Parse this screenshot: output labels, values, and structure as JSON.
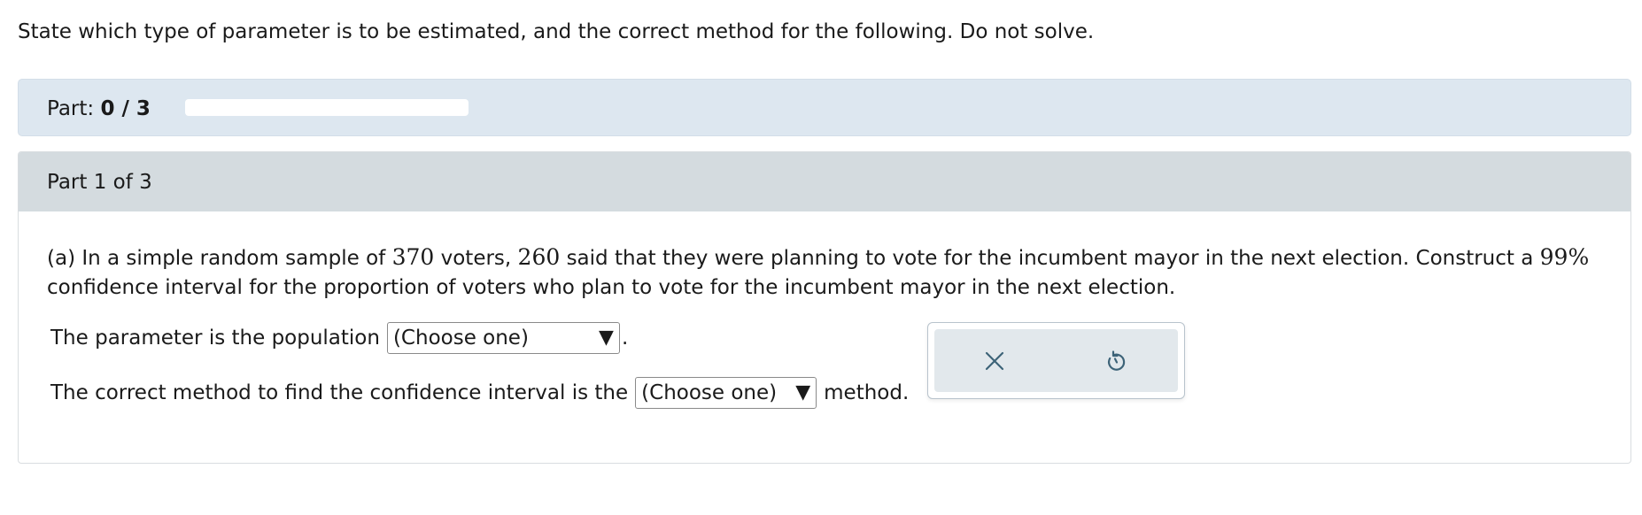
{
  "instructions": "State which type of parameter is to be estimated, and the correct method for the following. Do not solve.",
  "progress": {
    "label": "Part:",
    "current": 0,
    "total": 3,
    "value_text": "0 / 3",
    "fraction": 0
  },
  "part": {
    "title": "Part 1 of 3",
    "question": {
      "prefix": "(a) In a simple random sample of",
      "sample_size": "370",
      "mid1": "voters,",
      "count": "260",
      "mid2": "said that they were planning to vote for the incumbent mayor in the next election. Construct a",
      "confidence": "99%",
      "suffix": "confidence interval for the proportion of voters who plan to vote for the incumbent mayor in the next election."
    },
    "line1": {
      "text": "The parameter is the population",
      "select_value": "(Choose one)",
      "trailing": "."
    },
    "line2": {
      "text": "The correct method to find the confidence interval is the",
      "select_value": "(Choose one)",
      "trailing": "method."
    }
  },
  "tools": {
    "clear_icon": "close-icon",
    "reset_icon": "undo-icon"
  },
  "colors": {
    "part_bar_bg": "#dde7f0",
    "part_header_bg": "#d4dbdf",
    "tool_bg": "#e2e8ec",
    "icon_color": "#3d6378"
  }
}
